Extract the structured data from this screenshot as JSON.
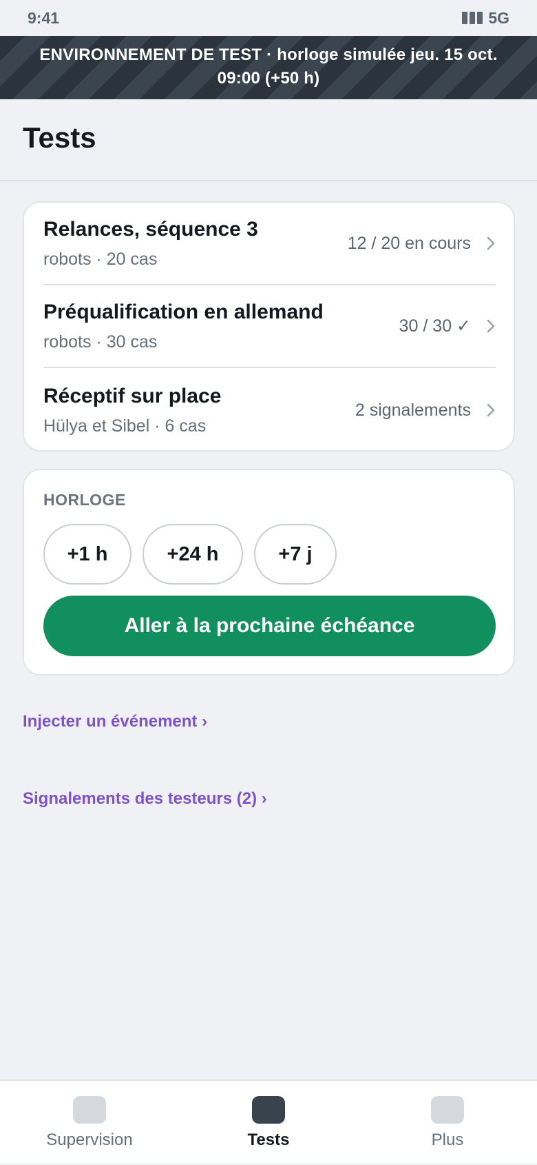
{
  "status_bar": {
    "time": "9:41",
    "network": "5G",
    "signal_icon": "signal-bars-icon"
  },
  "banner": {
    "text": "ENVIRONNEMENT DE TEST · horloge simulée jeu. 15 oct. 09:00 (+50 h)"
  },
  "header": {
    "title": "Tests"
  },
  "tests": [
    {
      "title": "Relances, séquence 3",
      "subtitle": "robots · 20 cas",
      "status": "12 / 20 en cours"
    },
    {
      "title": "Préqualification en allemand",
      "subtitle": "robots · 30 cas",
      "status": "30 / 30 ✓"
    },
    {
      "title": "Réceptif sur place",
      "subtitle": "Hülya et Sibel · 6 cas",
      "status": "2 signalements"
    }
  ],
  "clock": {
    "label": "HORLOGE",
    "chips": [
      "+1 h",
      "+24 h",
      "+7 j"
    ],
    "primary_action": "Aller à la prochaine échéance"
  },
  "links": {
    "inject_event": "Injecter un événement ›",
    "tester_reports": "Signalements des testeurs (2) ›"
  },
  "bottom_nav": {
    "items": [
      {
        "label": "Supervision",
        "icon": "supervision-icon"
      },
      {
        "label": "Tests",
        "icon": "tests-icon",
        "active": true
      },
      {
        "label": "Plus",
        "icon": "more-icon"
      }
    ]
  },
  "colors": {
    "accent_green": "#128f5f",
    "link_purple": "#7e53c9",
    "banner_dark": "#2b343d",
    "background": "#f0f1f5"
  }
}
